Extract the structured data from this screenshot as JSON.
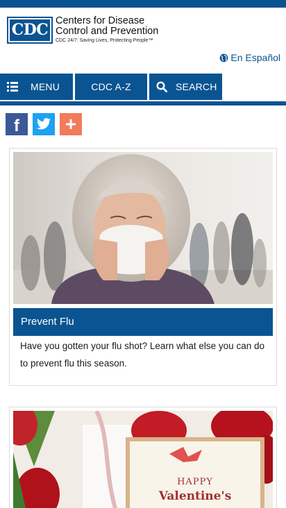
{
  "header": {
    "logo_mark": "CDC",
    "org_line1": "Centers for Disease",
    "org_line2": "Control and Prevention",
    "tagline": "CDC 24/7: Saving Lives, Protecting People™",
    "language_link": "En Español",
    "language_icon": "globe-icon"
  },
  "nav": {
    "menu_label": "MENU",
    "menu_icon": "list-icon",
    "az_label": "CDC A-Z",
    "search_label": "SEARCH",
    "search_icon": "search-icon"
  },
  "social": {
    "facebook_glyph": "f",
    "facebook_icon": "facebook-icon",
    "twitter_icon": "twitter-icon",
    "add_glyph": "+",
    "add_icon": "plus-icon"
  },
  "cards": [
    {
      "title": "Prevent Flu",
      "description": "Have you gotten your flu shot? Learn what else you can do to prevent flu this season.",
      "image": "woman-blowing-nose-photo"
    },
    {
      "image": "valentines-card-photo",
      "image_text_line1": "HAPPY",
      "image_text_line2": "Valentine's"
    }
  ],
  "colors": {
    "brand_blue": "#0a5492",
    "facebook": "#3b5998",
    "twitter": "#1da1f2",
    "addthis": "#f27b5b"
  }
}
